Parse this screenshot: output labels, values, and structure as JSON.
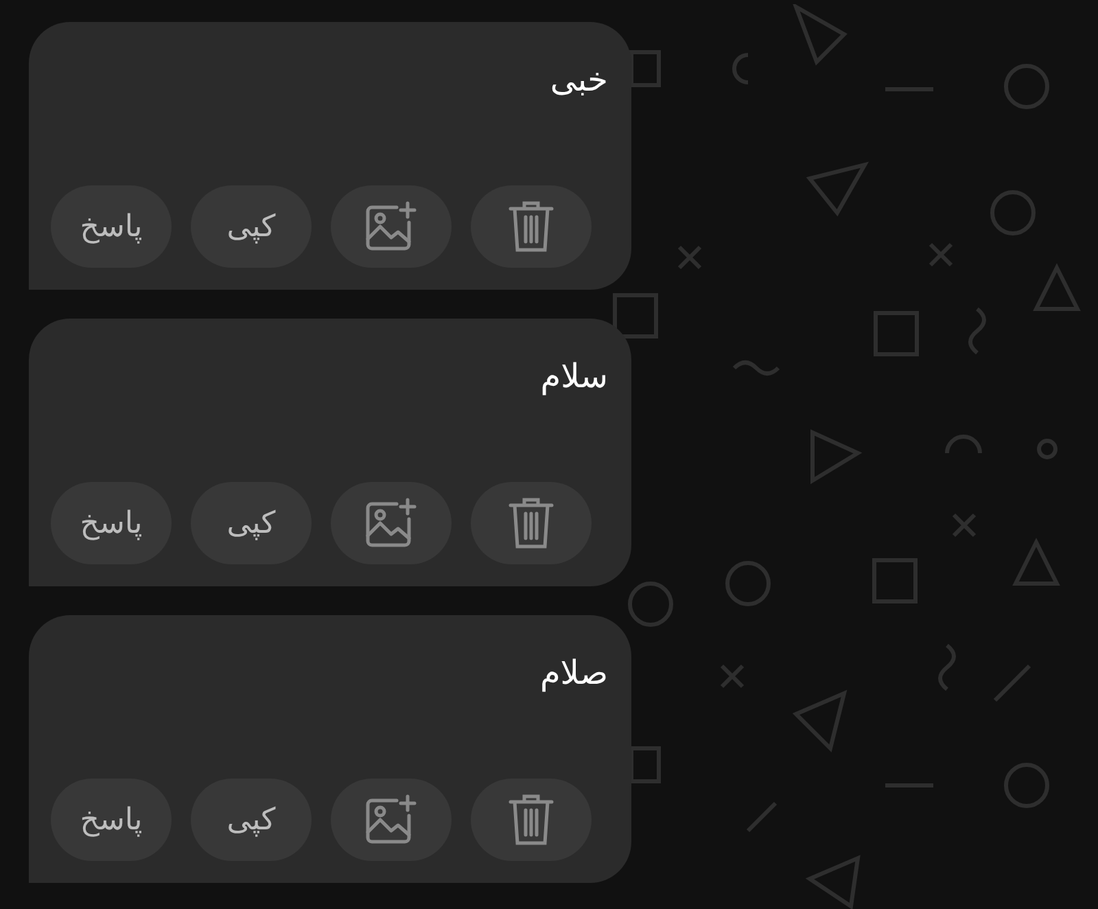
{
  "messages": [
    {
      "text": "خبی",
      "actions": [
        {
          "kind": "delete"
        },
        {
          "kind": "image"
        },
        {
          "kind": "copy",
          "label": "کپی"
        },
        {
          "kind": "reply",
          "label": "پاسخ"
        }
      ]
    },
    {
      "text": "سلام",
      "actions": [
        {
          "kind": "delete"
        },
        {
          "kind": "image"
        },
        {
          "kind": "copy",
          "label": "کپی"
        },
        {
          "kind": "reply",
          "label": "پاسخ"
        }
      ]
    },
    {
      "text": "صلام",
      "actions": [
        {
          "kind": "delete"
        },
        {
          "kind": "image"
        },
        {
          "kind": "copy",
          "label": "کپی"
        },
        {
          "kind": "reply",
          "label": "پاسخ"
        }
      ]
    }
  ]
}
